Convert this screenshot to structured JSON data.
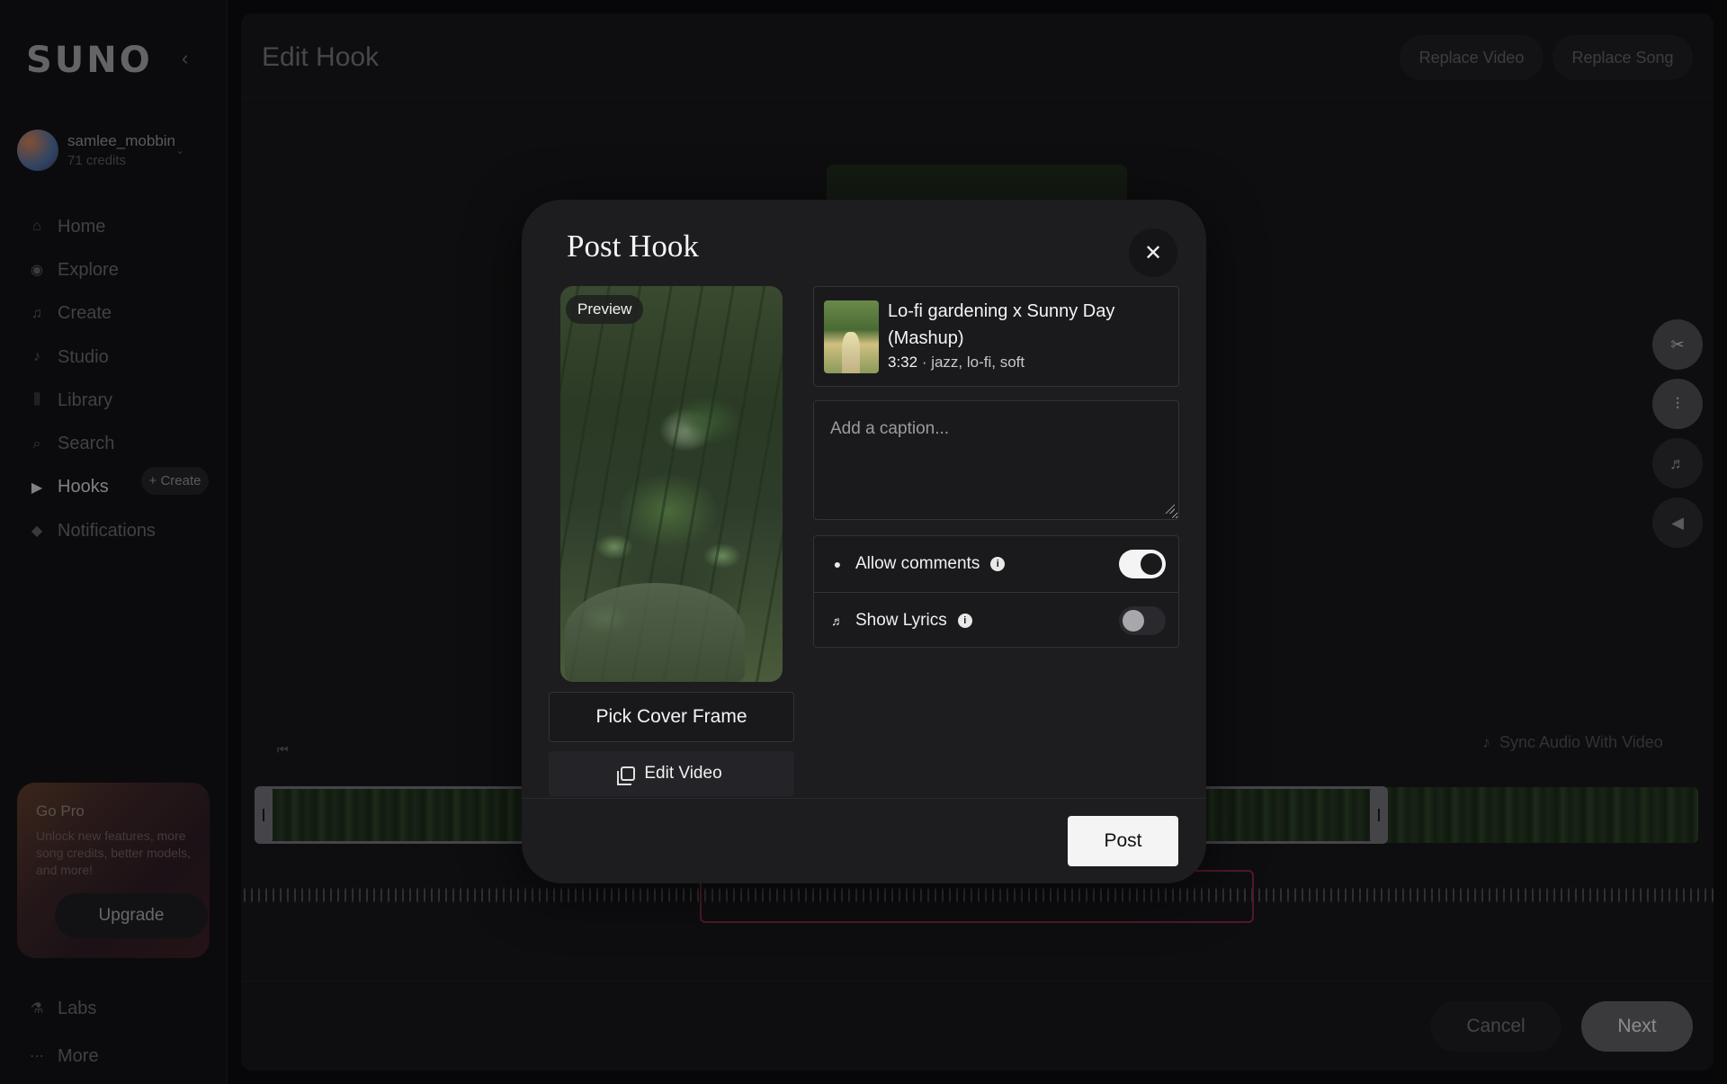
{
  "sidebar": {
    "logo": "SUNO",
    "collapse_icon": "chevron-left-icon",
    "user": {
      "name": "samlee_mobbin",
      "credits": "71 credits"
    },
    "nav": [
      {
        "label": "Home",
        "icon": "home-icon"
      },
      {
        "label": "Explore",
        "icon": "compass-icon"
      },
      {
        "label": "Create",
        "icon": "music-note-icon"
      },
      {
        "label": "Studio",
        "icon": "studio-icon"
      },
      {
        "label": "Library",
        "icon": "library-icon"
      },
      {
        "label": "Search",
        "icon": "search-icon"
      },
      {
        "label": "Hooks",
        "icon": "hooks-icon"
      },
      {
        "label": "Notifications",
        "icon": "bell-icon"
      }
    ],
    "hooks_create": "+ Create",
    "gopro": {
      "title": "Go Pro",
      "description": "Unlock new features, more song credits, better models, and more!",
      "upgrade": "Upgrade"
    },
    "labs": "Labs",
    "more": "More"
  },
  "main": {
    "title": "Edit Hook",
    "replace_video": "Replace Video",
    "replace_song": "Replace Song",
    "sync_audio": "Sync Audio With Video",
    "cancel": "Cancel",
    "next": "Next"
  },
  "modal": {
    "title": "Post Hook",
    "close_icon": "close-icon",
    "preview_badge": "Preview",
    "pick_cover": "Pick Cover Frame",
    "edit_video": "Edit Video",
    "song": {
      "title": "Lo-fi gardening x Sunny Day (Mashup)",
      "duration": "3:32",
      "tags": " · jazz, lo-fi, soft"
    },
    "caption_placeholder": "Add a caption...",
    "allow_comments": {
      "label": "Allow comments",
      "enabled": true
    },
    "show_lyrics": {
      "label": "Show Lyrics",
      "enabled": false
    },
    "post": "Post"
  },
  "colors": {
    "accent_selection": "#7a2840",
    "modal_bg": "#1d1d20",
    "primary_button": "#f4f4f4"
  }
}
